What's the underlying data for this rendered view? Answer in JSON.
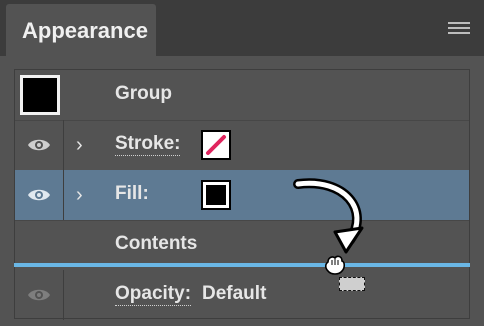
{
  "panel": {
    "tab_title": "Appearance",
    "menu_icon": "panel-menu-icon"
  },
  "rows": {
    "group": {
      "label": "Group",
      "swatch_color": "#000000"
    },
    "stroke": {
      "label": "Stroke:",
      "icon": "stroke-none-swatch-icon",
      "slash_color": "#e0245e"
    },
    "fill": {
      "label": "Fill:",
      "swatch_color": "#000000",
      "selected": true
    },
    "contents": {
      "label": "Contents"
    },
    "opacity": {
      "label": "Opacity:",
      "value": "Default"
    }
  },
  "colors": {
    "selection": "#5e7a93",
    "drop_indicator": "#6ab7e6"
  }
}
